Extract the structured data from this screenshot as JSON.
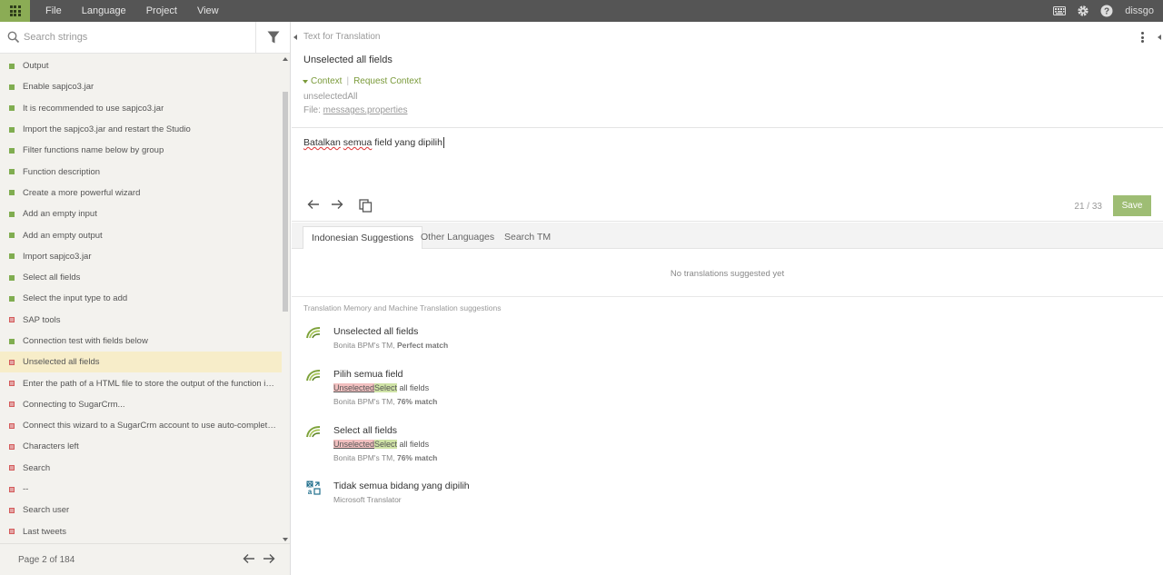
{
  "topbar": {
    "menu": [
      "File",
      "Language",
      "Project",
      "View"
    ],
    "icons": [
      "keyboard-icon",
      "gear-icon",
      "help-icon"
    ],
    "username": "dissgo",
    "accent": "#8bac55"
  },
  "left": {
    "search_placeholder": "Search strings",
    "items": [
      {
        "label": "Output",
        "status": "green"
      },
      {
        "label": "Enable sapjco3.jar",
        "status": "green"
      },
      {
        "label": "It is recommended to use sapjco3.jar",
        "status": "green"
      },
      {
        "label": "Import the sapjco3.jar and restart the Studio",
        "status": "green"
      },
      {
        "label": "Filter functions name below by group",
        "status": "green"
      },
      {
        "label": "Function description",
        "status": "green"
      },
      {
        "label": "Create a more powerful wizard",
        "status": "green"
      },
      {
        "label": "Add an empty input",
        "status": "green"
      },
      {
        "label": "Add an empty output",
        "status": "green"
      },
      {
        "label": "Import sapjco3.jar",
        "status": "green"
      },
      {
        "label": "Select all fields",
        "status": "green"
      },
      {
        "label": "Select the input type to add",
        "status": "green"
      },
      {
        "label": "SAP tools",
        "status": "red"
      },
      {
        "label": "Connection test with fields below",
        "status": "green"
      },
      {
        "label": "Unselected all fields",
        "status": "red"
      },
      {
        "label": "Enter the path of a HTML file to store the output of the function in ...",
        "status": "red"
      },
      {
        "label": "Connecting to SugarCrm...",
        "status": "red"
      },
      {
        "label": "Connect this wizard to a SugarCrm account to use auto-completio...",
        "status": "red"
      },
      {
        "label": "Characters left",
        "status": "red"
      },
      {
        "label": "Search",
        "status": "red"
      },
      {
        "label": "--",
        "status": "red"
      },
      {
        "label": "Search user",
        "status": "red"
      },
      {
        "label": "Last tweets",
        "status": "red"
      }
    ],
    "selected_index": 14,
    "page_text": "Page 2 of 184"
  },
  "editor": {
    "source_label": "Text for Translation",
    "source_text": "Unselected all fields",
    "context_label": "Context",
    "request_context_label": "Request Context",
    "context_key": "unselectedAll",
    "file_prefix": "File: ",
    "file_name": "messages.properties",
    "translation_words": [
      "Batalkan",
      " ",
      "semua",
      " field yang dipilih"
    ],
    "counter": "21 / 33",
    "save_label": "Save"
  },
  "tabs": [
    "Indonesian Suggestions",
    "Other Languages",
    "Search TM"
  ],
  "no_suggestions": "No translations suggested yet",
  "tm_header": "Translation Memory and Machine Translation suggestions",
  "suggestions": [
    {
      "title": "Unselected all fields",
      "meta_source": "Bonita BPM's TM, ",
      "meta_match": "Perfect match",
      "icon": "tm-icon"
    },
    {
      "title": "Pilih semua field",
      "diff_del": "Unselected",
      "diff_ins": "Select",
      "diff_rest": " all fields",
      "meta_source": "Bonita BPM's TM, ",
      "meta_match": "76% match",
      "icon": "tm-icon"
    },
    {
      "title": "Select all fields",
      "diff_del": "Unselected",
      "diff_ins": "Select",
      "diff_rest": " all fields",
      "meta_source": "Bonita BPM's TM, ",
      "meta_match": "76% match",
      "icon": "tm-icon"
    },
    {
      "title": "Tidak semua bidang yang dipilih",
      "meta_source": "Microsoft Translator",
      "icon": "translator-icon"
    }
  ]
}
